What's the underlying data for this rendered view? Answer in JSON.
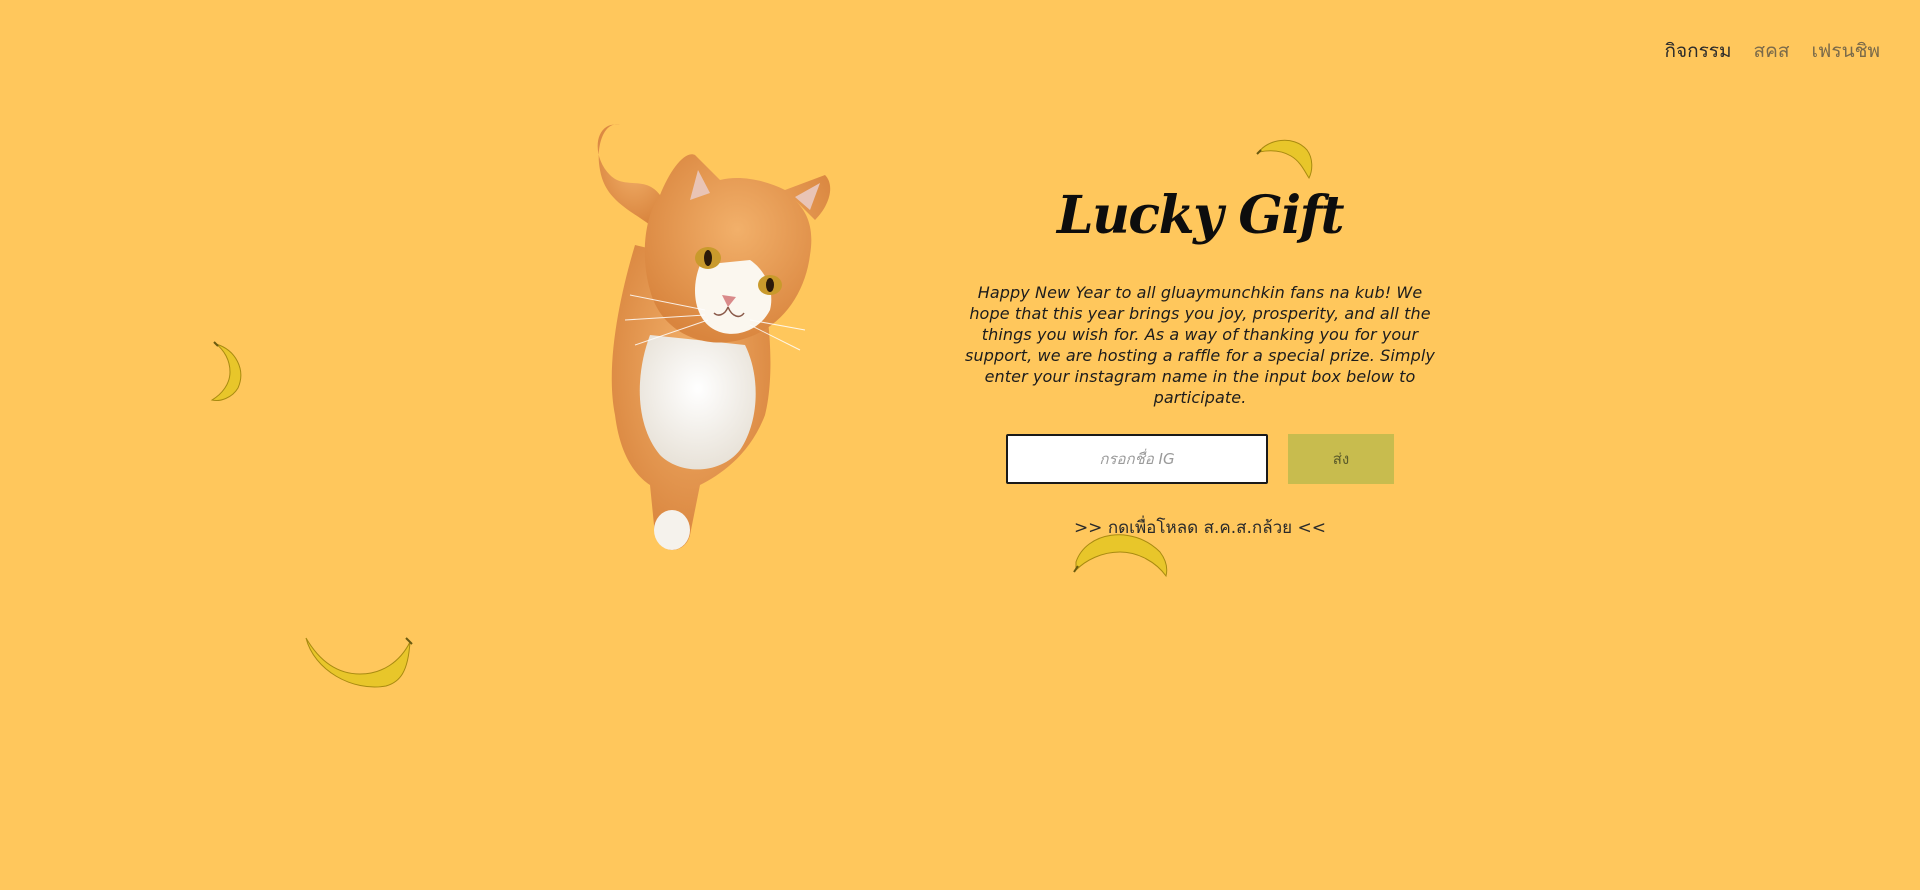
{
  "nav": {
    "items": [
      {
        "label": "กิจกรรม",
        "active": true
      },
      {
        "label": "สคส",
        "active": false
      },
      {
        "label": "เฟรนชิพ",
        "active": false
      }
    ]
  },
  "hero": {
    "title": "Lucky Gift",
    "description": "Happy New Year to all gluaymunchkin fans na kub! We hope that this year brings you joy, prosperity, and all the things you wish for. As a way of thanking you for your support, we are hosting a raffle for a special prize. Simply enter your instagram name in the input box below to participate."
  },
  "form": {
    "input_value": "",
    "input_placeholder": "กรอกชื่อ IG",
    "submit_label": "ส่ง"
  },
  "download": {
    "label": ">> กดเพื่อโหลด ส.ค.ส.กล้วย <<"
  },
  "colors": {
    "background": "#FFC75C",
    "button": "#C8BC4E",
    "banana": "#E8C62A"
  },
  "images": {
    "cat": "orange-white-cat-photo",
    "banana": "banana-icon"
  }
}
